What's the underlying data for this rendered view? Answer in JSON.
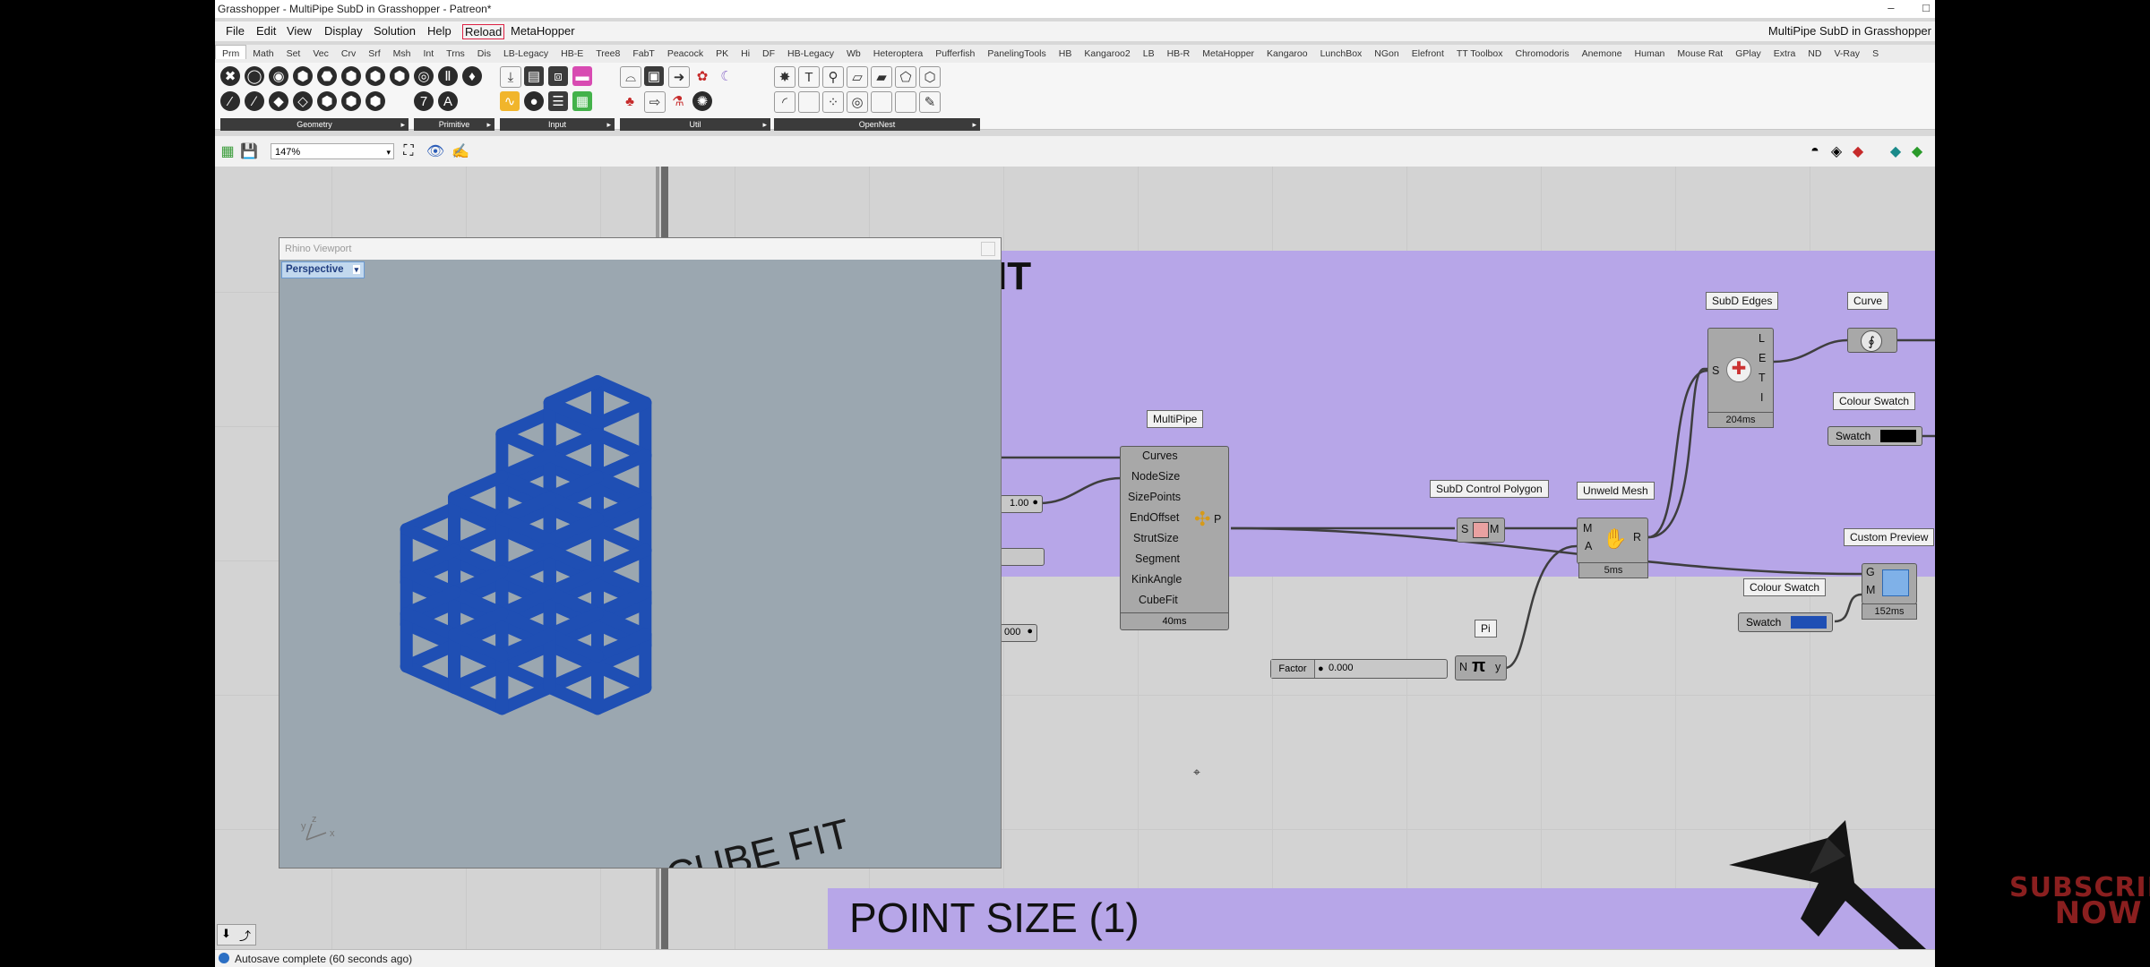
{
  "window": {
    "title": "Grasshopper - MultiPipe SubD in Grasshopper - Patreon*",
    "file_title": "MultiPipe SubD in Grasshopper",
    "controls": [
      "–",
      "□"
    ]
  },
  "menu": [
    "File",
    "Edit",
    "View",
    "Display",
    "Solution",
    "Help",
    "Reload",
    "MetaHopper"
  ],
  "tabs": [
    "Prm",
    "Math",
    "Set",
    "Vec",
    "Crv",
    "Srf",
    "Msh",
    "Int",
    "Trns",
    "Dis",
    "LB-Legacy",
    "HB-E",
    "Tree8",
    "FabT",
    "Peacock",
    "PK",
    "Hi",
    "DF",
    "HB-Legacy",
    "Wb",
    "Heteroptera",
    "Pufferfish",
    "PanelingTools",
    "HB",
    "Kangaroo2",
    "LB",
    "HB-R",
    "MetaHopper",
    "Kangaroo",
    "LunchBox",
    "NGon",
    "Elefront",
    "TT Toolbox",
    "Chromodoris",
    "Anemone",
    "Human",
    "Mouse Rat",
    "GPlay",
    "Extra",
    "ND",
    "V-Ray",
    "S"
  ],
  "ribbon_groups": [
    "Geometry",
    "Primitive",
    "Input",
    "Util",
    "OpenNest"
  ],
  "zoom": "147%",
  "viewport": {
    "title": "Rhino Viewport",
    "view": "Perspective",
    "caption": "CUBE FIT"
  },
  "group_headline_fragment": "IT",
  "bottom_headline": "POINT SIZE (1)",
  "nodes": {
    "multipipe": {
      "label": "MultiPipe",
      "inputs": [
        "Curves",
        "NodeSize",
        "SizePoints",
        "EndOffset",
        "StrutSize",
        "Segment",
        "KinkAngle",
        "CubeFit"
      ],
      "output": "P",
      "time": "40ms"
    },
    "subd_control": {
      "label": "SubD Control Polygon",
      "in": "S",
      "out": "M"
    },
    "unweld": {
      "label": "Unweld Mesh",
      "in1": "M",
      "in2": "A",
      "out": "R",
      "time": "5ms"
    },
    "subd_edges": {
      "label": "SubD Edges",
      "in": "S",
      "outs": [
        "L",
        "E",
        "T",
        "I"
      ],
      "time": "204ms"
    },
    "curve": {
      "label": "Curve"
    },
    "swatch1": {
      "label": "Colour Swatch",
      "text": "Swatch",
      "color": "#000000"
    },
    "swatch2": {
      "label": "Colour Swatch",
      "text": "Swatch",
      "color": "#1f4fb4"
    },
    "custom_preview": {
      "label": "Custom Preview",
      "in1": "G",
      "in2": "M",
      "time": "152ms"
    },
    "pi": {
      "label": "Pi",
      "in": "N",
      "symbol": "π",
      "out": "y"
    },
    "factor": {
      "label": "Factor",
      "value": "0.000"
    },
    "slider_a": {
      "value": "1.00"
    },
    "slider_b": {
      "value": "000"
    }
  },
  "status": "Autosave complete (60 seconds ago)",
  "subscribe": [
    "SUBSCRIBE",
    "NOW"
  ],
  "colors": {
    "group": "#b7a6e8",
    "mesh": "#1f4fb4",
    "accent": "#8a1f1f"
  }
}
